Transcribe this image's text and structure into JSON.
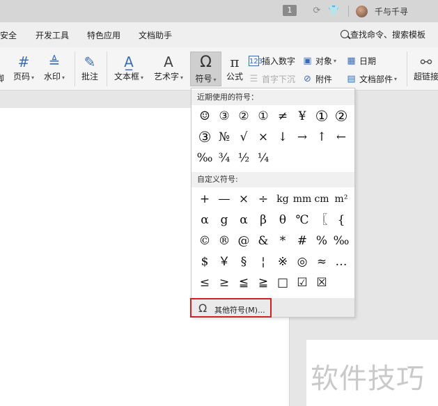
{
  "titlebar": {
    "badge_num": "1",
    "user_name": "千与千寻"
  },
  "menu_tabs": [
    "安全",
    "开发工具",
    "特色应用",
    "文档助手"
  ],
  "search": {
    "label": "查找命令、搜索模板"
  },
  "ribbon": {
    "partial_left": "脚",
    "page_number": "页码",
    "watermark": "水印",
    "annotation": "批注",
    "textbox": "文本框",
    "wordart": "艺术字",
    "symbol": "符号",
    "formula": "公式",
    "insert_number": "插入数字",
    "drop_cap": "首字下沉",
    "object": "对象",
    "attachment": "附件",
    "date": "日期",
    "doc_parts": "文档部件",
    "hyperlink": "超链接"
  },
  "dropdown": {
    "recent_header": "近期使用的符号：",
    "recent_symbols": [
      "☺",
      "③",
      "②",
      "①",
      "≠",
      "¥",
      "①",
      "②",
      "③",
      "№",
      "√",
      "×",
      "↓",
      "→",
      "↑",
      "←",
      "‰",
      "¾",
      "½",
      "¼"
    ],
    "custom_header": "自定义符号:",
    "custom_symbols": [
      "+",
      "—",
      "×",
      "÷",
      "kg",
      "mm",
      "cm",
      "m²",
      "α",
      "g",
      "α",
      "β",
      "θ",
      "℃",
      "〖",
      "{",
      "©",
      "®",
      "@",
      "&",
      "*",
      "#",
      "%",
      "‰",
      "$",
      "￥",
      "§",
      "¦",
      "※",
      "◎",
      "≈",
      "…",
      "≤",
      "≥",
      "≦",
      "≧",
      "□",
      "☑",
      "☒"
    ],
    "more_label": "其他符号(M)..."
  },
  "document": {
    "watermark_text": "软件技巧"
  }
}
